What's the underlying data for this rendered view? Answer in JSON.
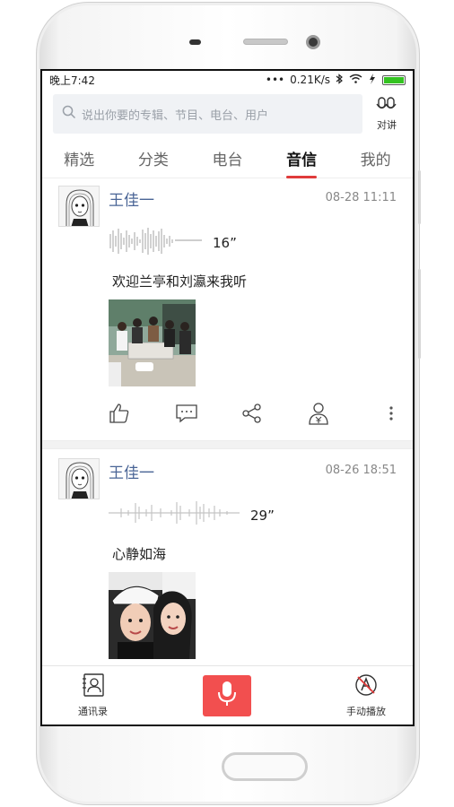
{
  "status": {
    "time": "晚上7:42",
    "dots": "•••",
    "speed": "0.21K/s"
  },
  "search": {
    "placeholder": "说出你要的专辑、节目、电台、用户",
    "talk_label": "对讲"
  },
  "tabs": [
    {
      "label": "精选"
    },
    {
      "label": "分类"
    },
    {
      "label": "电台"
    },
    {
      "label": "音信",
      "active": true
    },
    {
      "label": "我的"
    }
  ],
  "posts": [
    {
      "author": "王佳一",
      "time": "08-28 11:11",
      "duration": "16”",
      "text": "欢迎兰亭和刘瀛来我听"
    },
    {
      "author": "王佳一",
      "time": "08-26 18:51",
      "duration": "29”",
      "text": "心静如海"
    }
  ],
  "bottom": {
    "contacts_label": "通讯录",
    "autoplay_label": "手动播放"
  },
  "colors": {
    "accent": "#e03b3b",
    "mic_button": "#f24f4f",
    "author_name": "#4a6596",
    "battery": "#34c321"
  },
  "icons": [
    "search-icon",
    "talk-icon",
    "bluetooth-icon",
    "wifi-icon",
    "signal-icon",
    "battery-icon",
    "like-icon",
    "comment-icon",
    "share-icon",
    "reward-icon",
    "more-icon",
    "contacts-icon",
    "mic-icon",
    "autoplay-icon"
  ]
}
